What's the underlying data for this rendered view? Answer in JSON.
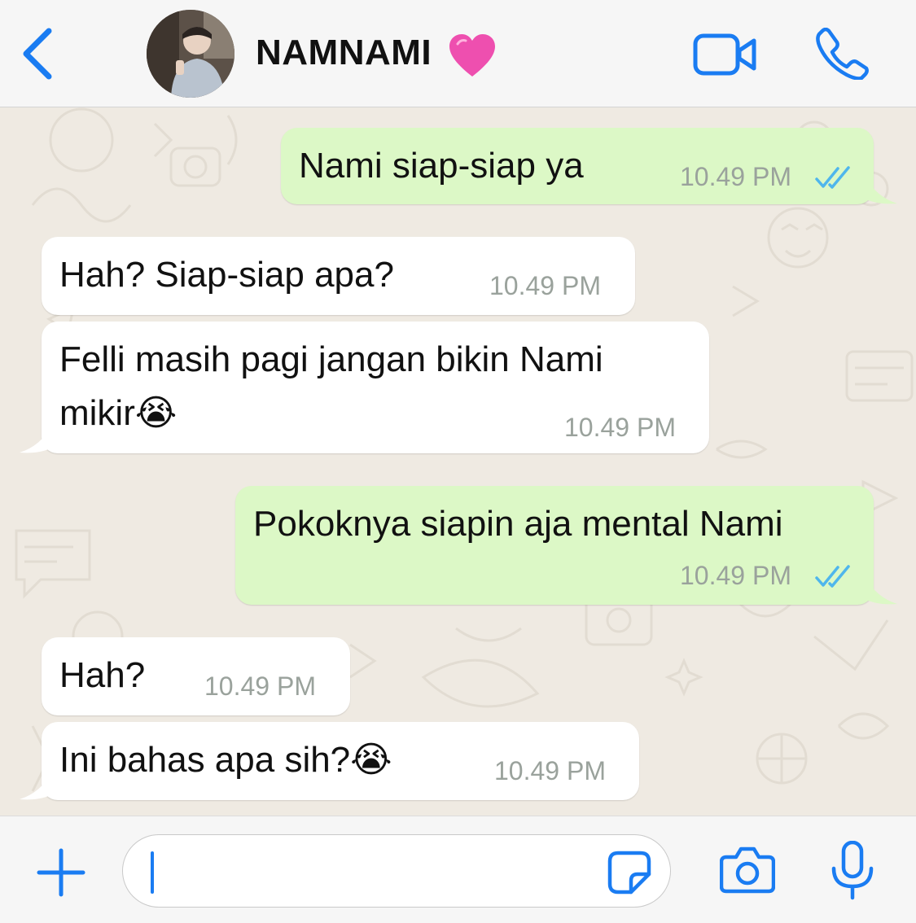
{
  "header": {
    "contact_name": "NAMNAMI",
    "heart_emoji": "💗",
    "icons": {
      "back": "chevron-left-icon",
      "video": "video-camera-icon",
      "call": "phone-icon"
    }
  },
  "messages": [
    {
      "direction": "outgoing",
      "text": "Nami siap-siap ya",
      "time": "10.49 PM",
      "status": "read"
    },
    {
      "direction": "incoming",
      "text": "Hah? Siap-siap apa?",
      "time": "10.49 PM"
    },
    {
      "direction": "incoming",
      "text_line1": "Felli masih pagi jangan bikin Nami",
      "text_line2": "mikir",
      "emoji": "😭",
      "time": "10.49 PM"
    },
    {
      "direction": "outgoing",
      "text": "Pokoknya siapin aja mental Nami",
      "time": "10.49 PM",
      "status": "read"
    },
    {
      "direction": "incoming",
      "text": "Hah?",
      "time": "10.49 PM"
    },
    {
      "direction": "incoming",
      "text": "Ini bahas apa sih?",
      "emoji": "😭",
      "time": "10.49 PM"
    }
  ],
  "input_bar": {
    "message_value": "",
    "icons": {
      "attach": "plus-icon",
      "sticker": "sticker-icon",
      "camera": "camera-icon",
      "mic": "microphone-icon"
    }
  },
  "colors": {
    "accent": "#1a7cf2",
    "outgoing_bubble": "#dcf8c6",
    "incoming_bubble": "#ffffff",
    "chat_background": "#efeae2",
    "read_ticks": "#4fb6ec",
    "timestamp": "#9aa29c"
  }
}
